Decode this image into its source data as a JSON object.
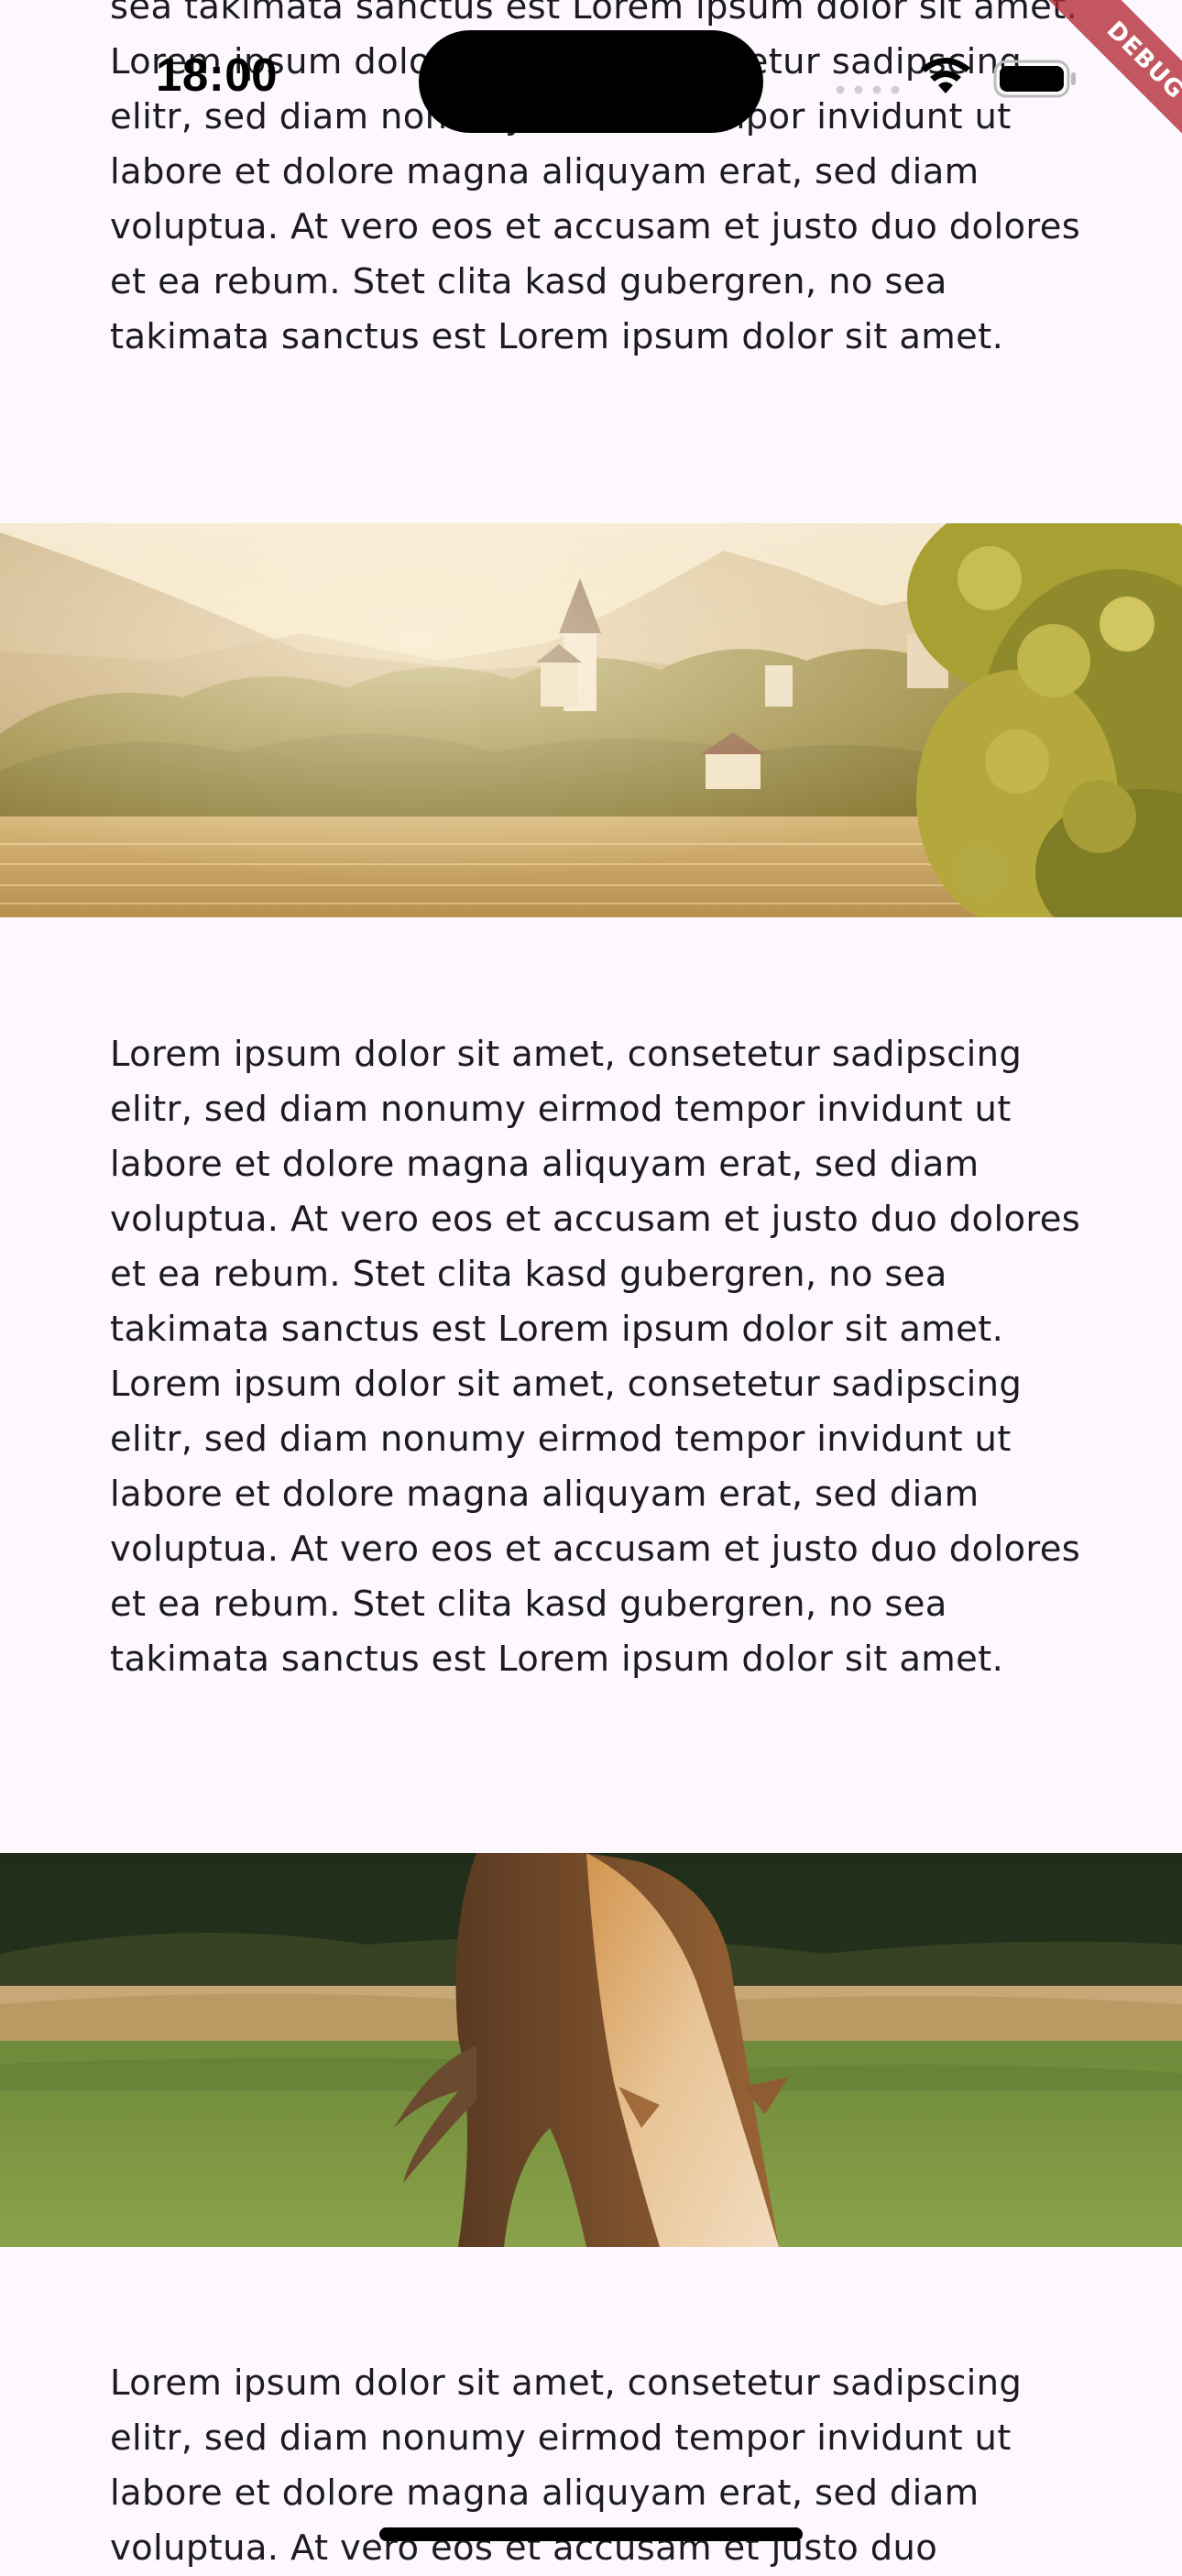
{
  "status_bar": {
    "time": "18:00"
  },
  "debug_banner": {
    "label": "DEBUG"
  },
  "content": {
    "paragraph_top": "sea takimata sanctus est Lorem ipsum dolor sit amet. Lorem ipsum dolor sit amet, consetetur sadipscing elitr, sed diam nonumy eirmod tempor invidunt ut labore et dolore magna aliquyam erat, sed diam voluptua. At vero eos et accusam et justo duo dolores et ea rebum. Stet clita kasd gubergren, no sea takimata sanctus est Lorem ipsum dolor sit amet.",
    "image_1": "lake-village-with-church-photo",
    "paragraph_middle": "Lorem ipsum dolor sit amet, consetetur sadipscing elitr, sed diam nonumy eirmod tempor invidunt ut labore et dolore magna aliquyam erat, sed diam voluptua. At vero eos et accusam et justo duo dolores et ea rebum. Stet clita kasd gubergren, no sea takimata sanctus est Lorem ipsum dolor sit amet. Lorem ipsum dolor sit amet, consetetur sadipscing elitr, sed diam nonumy eirmod tempor invidunt ut labore et dolore magna aliquyam erat, sed diam voluptua. At vero eos et accusam et justo duo dolores et ea rebum. Stet clita kasd gubergren, no sea takimata sanctus est Lorem ipsum dolor sit amet.",
    "image_2": "grazing-horse-photo",
    "paragraph_bottom": "Lorem ipsum dolor sit amet, consetetur sadipscing elitr, sed diam nonumy eirmod tempor invidunt ut labore et dolore magna aliquyam erat, sed diam voluptua. At vero eos et accusam et justo duo"
  },
  "colors": {
    "background": "#fdf8fd",
    "text": "#1c1b1f",
    "debug_ribbon": "#b22834"
  }
}
